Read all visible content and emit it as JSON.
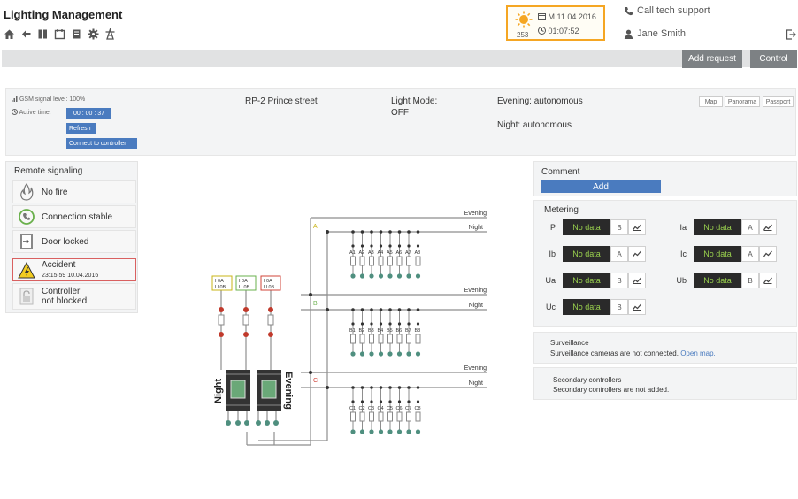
{
  "app": {
    "title": "Lighting Management"
  },
  "toolbar": {
    "icons": [
      "home-icon",
      "back-icon",
      "book-icon",
      "calendar-icon",
      "document-icon",
      "gear-icon",
      "tower-icon"
    ]
  },
  "weather": {
    "temperature": "253",
    "date": "M 11.04.2016",
    "time": "01:07:52"
  },
  "header": {
    "call_support": "Call tech support",
    "user_name": "Jane Smith"
  },
  "actions": {
    "add_request": "Add request",
    "control": "Control"
  },
  "info": {
    "gsm_signal": "GSM signal level: 100%",
    "active_time_label": "Active time:",
    "active_time": "00 : 00 : 37",
    "refresh": "Refresh",
    "connect": "Connect to controller",
    "location": "RP-2 Prince street",
    "light_mode_label": "Light Mode:",
    "light_mode_value": "OFF",
    "evening": "Evening: autonomous",
    "night": "Night: autonomous",
    "tabs": [
      "Map",
      "Panorama",
      "Passport"
    ]
  },
  "remote": {
    "title": "Remote signaling",
    "items": [
      {
        "label": "No fire",
        "icon": "fire-icon"
      },
      {
        "label": "Connection stable",
        "icon": "connection-icon"
      },
      {
        "label": "Door locked",
        "icon": "door-icon"
      },
      {
        "label": "Accident",
        "sub": "23:15:59 10.04.2016",
        "icon": "warning-icon"
      },
      {
        "label": "Controller",
        "sub2": "not blocked",
        "icon": "lock-icon"
      }
    ]
  },
  "comment": {
    "title": "Comment",
    "add": "Add"
  },
  "metering": {
    "title": "Metering",
    "rows": [
      {
        "name": "P",
        "value": "No data",
        "phase": "B"
      },
      {
        "name": "Ia",
        "value": "No data",
        "phase": "A"
      },
      {
        "name": "Ib",
        "value": "No data",
        "phase": "A"
      },
      {
        "name": "Ic",
        "value": "No data",
        "phase": "A"
      },
      {
        "name": "Ua",
        "value": "No data",
        "phase": "B"
      },
      {
        "name": "Ub",
        "value": "No data",
        "phase": "B"
      },
      {
        "name": "Uc",
        "value": "No data",
        "phase": "B"
      }
    ]
  },
  "surveillance": {
    "title": "Surveillance",
    "text": "Surveillance cameras are not connected.",
    "link": "Open map."
  },
  "secondary": {
    "title": "Secondary controllers",
    "text": "Secondary controllers are not added."
  },
  "diagram": {
    "line_evening": "Evening",
    "line_night": "Night",
    "phase_a": "A",
    "phase_b": "B",
    "phase_c": "C",
    "contactor_night": "Night",
    "contactor_evening": "Evening",
    "groups": [
      [
        "A1",
        "A2",
        "A3",
        "A4",
        "A5",
        "A6",
        "A7",
        "A8"
      ],
      [
        "B1",
        "B2",
        "B3",
        "B4",
        "B5",
        "B6",
        "B7",
        "B8"
      ],
      [
        "C1",
        "C2",
        "C3",
        "C4",
        "C5",
        "C6",
        "C7",
        "C8"
      ]
    ],
    "breakers": [
      {
        "top": "I 0A",
        "bottom": "U 0B"
      },
      {
        "top": "I 0A",
        "bottom": "U 0B"
      },
      {
        "top": "I 0A",
        "bottom": "U 0B"
      }
    ],
    "phase_colors": {
      "a": "#d8c21a",
      "b": "#6ab04c",
      "c": "#d0443a"
    }
  }
}
